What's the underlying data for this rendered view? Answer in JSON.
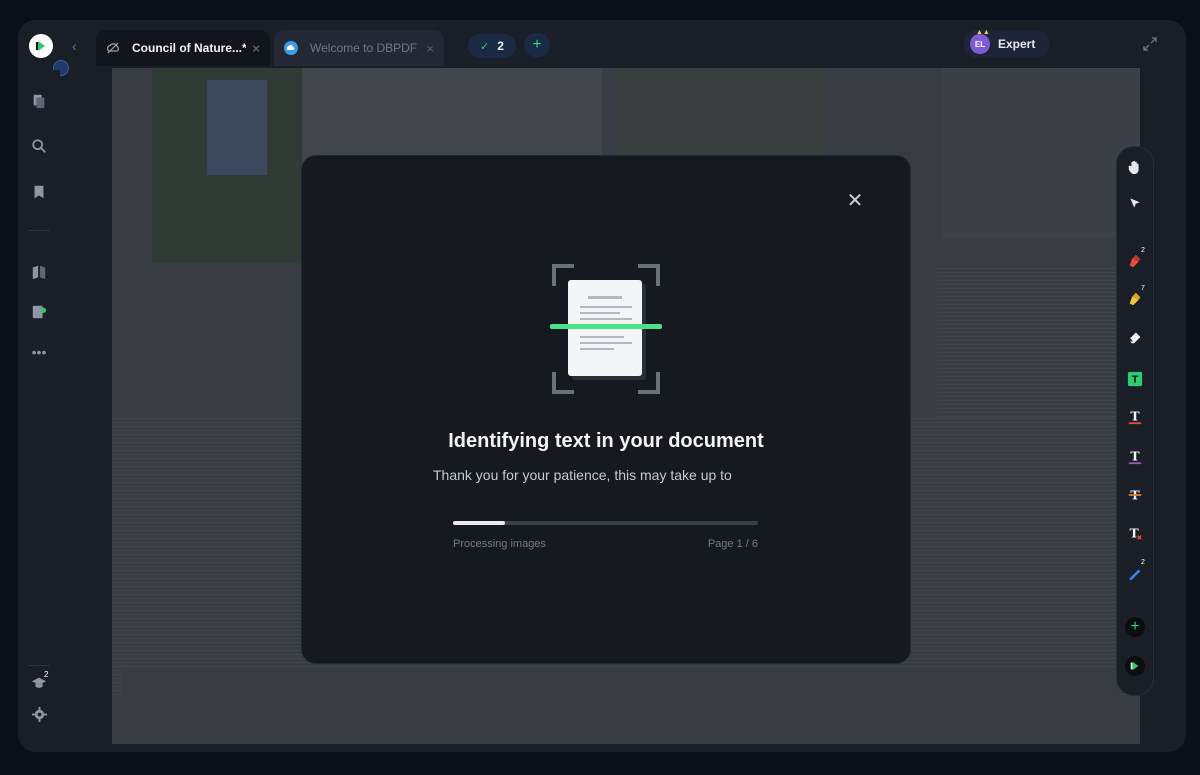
{
  "tabs": [
    {
      "label": "Council of Nature...*",
      "active": true
    },
    {
      "label": "Welcome to DBPDF",
      "active": false
    }
  ],
  "tab_count": "2",
  "user": {
    "initials": "EL",
    "plan": "Expert"
  },
  "left_sidebar": {
    "learn_badge": "2"
  },
  "right_toolbar": {
    "badges": {
      "highlighter_red": "2",
      "highlighter_yellow": "7",
      "pen": "2"
    }
  },
  "modal": {
    "title": "Identifying text in your document",
    "subtitle": "Thank you for your patience, this may take up to",
    "status": "Processing images",
    "page": "Page 1 / 6",
    "progress": 0.17
  },
  "colors": {
    "accent_green": "#36d17e",
    "scan_line": "#4be38a",
    "avatar": "#7b5cd6"
  }
}
